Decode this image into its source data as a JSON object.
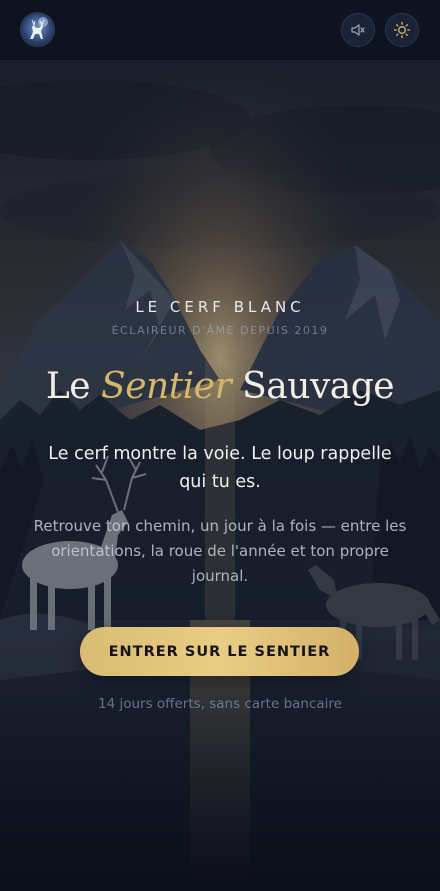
{
  "header": {
    "logo_alt": "Le Cerf Blanc logo",
    "mute_icon": "speaker-muted-icon",
    "theme_icon": "sun-icon"
  },
  "hero": {
    "brand": "LE CERF BLANC",
    "since": "ÉCLAIREUR D'ÂME DEPUIS 2019",
    "title_before": "Le ",
    "title_accent": "Sentier",
    "title_after": " Sauvage",
    "subtitle": "Le cerf montre la voie. Le loup rappelle qui tu es.",
    "description": "Retrouve ton chemin, un jour à la fois — entre les orientations, la roue de l'année et ton propre journal.",
    "cta_label": "ENTRER SUR LE SENTIER",
    "note": "14 jours offerts, sans carte bancaire"
  },
  "colors": {
    "background": "#0b0f1a",
    "header": "#0d1320",
    "gold_accent": "#d6b66a",
    "cta_gold": "#e3c57d"
  }
}
